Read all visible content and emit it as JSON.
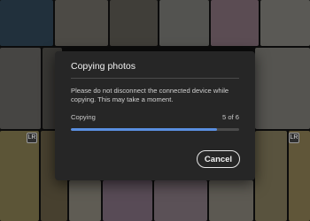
{
  "dialog": {
    "title": "Copying photos",
    "message": "Please do not disconnect the connected device while copying. This may take a moment.",
    "progress_label": "Copying",
    "progress_count": "5 of 6",
    "progress_fraction": 0.87,
    "cancel_label": "Cancel"
  },
  "badges": {
    "left": "LR",
    "right": "LR"
  },
  "colors": {
    "progress_accent": "#5a8fe0",
    "dialog_background": "#262626"
  }
}
